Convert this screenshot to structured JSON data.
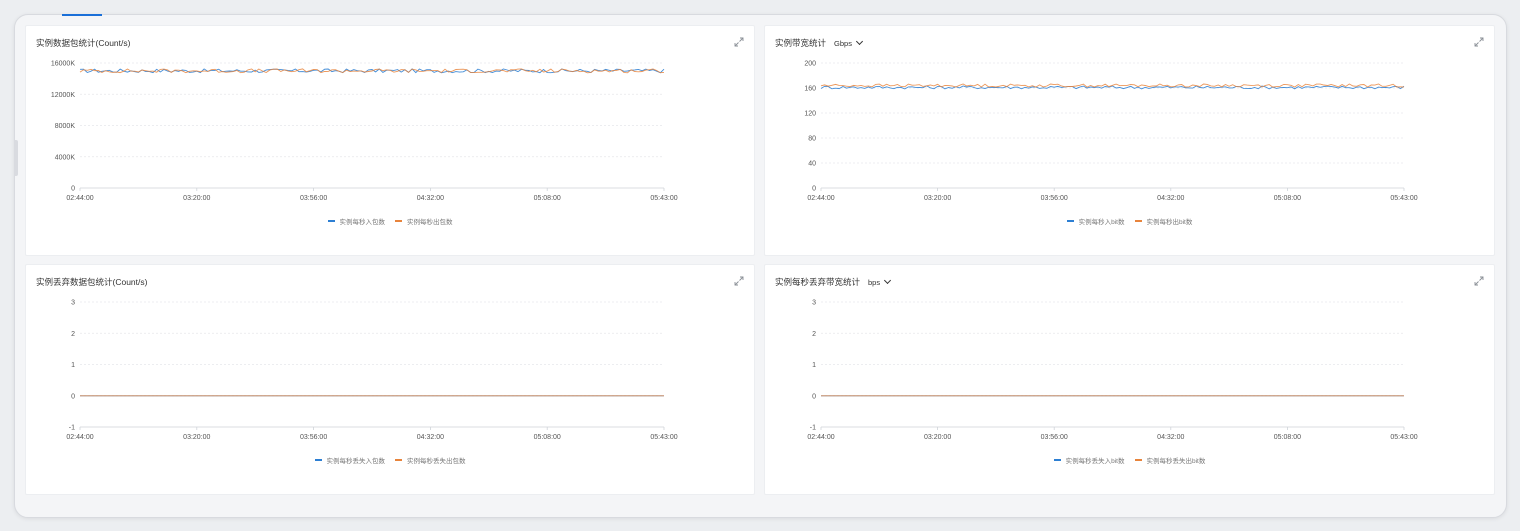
{
  "colors": {
    "series_in": "#2d7fd3",
    "series_out": "#e8843c",
    "grid": "#e6e8eb",
    "axis": "#cfd3d8"
  },
  "panels": [
    {
      "title": "实例数据包统计(Count/s)",
      "unit": "",
      "legend": [
        "实例每秒入包数",
        "实例每秒出包数"
      ]
    },
    {
      "title": "实例带宽统计",
      "unit": "Gbps",
      "legend": [
        "实例每秒入bit数",
        "实例每秒出bit数"
      ]
    },
    {
      "title": "实例丢弃数据包统计(Count/s)",
      "unit": "",
      "legend": [
        "实例每秒丢失入包数",
        "实例每秒丢失出包数"
      ]
    },
    {
      "title": "实例每秒丢弃带宽统计",
      "unit": "bps",
      "legend": [
        "实例每秒丢失入bit数",
        "实例每秒丢失出bit数"
      ]
    }
  ],
  "chart_data": [
    {
      "type": "line",
      "title": "实例数据包统计(Count/s)",
      "x_ticks": [
        "02:44:00",
        "03:20:00",
        "03:56:00",
        "04:32:00",
        "05:08:00",
        "05:43:00"
      ],
      "y_ticks": [
        "0",
        "4000K",
        "8000K",
        "12000K",
        "16000K"
      ],
      "ylim": [
        0,
        16000
      ],
      "y_unit": "K",
      "series": [
        {
          "name": "实例每秒入包数",
          "level": 15000,
          "noise": 250
        },
        {
          "name": "实例每秒出包数",
          "level": 15000,
          "noise": 250
        }
      ],
      "grid": true,
      "legend_position": "bottom"
    },
    {
      "type": "line",
      "title": "实例带宽统计",
      "x_ticks": [
        "02:44:00",
        "03:20:00",
        "03:56:00",
        "04:32:00",
        "05:08:00",
        "05:43:00"
      ],
      "y_ticks": [
        "0",
        "40",
        "80",
        "120",
        "160",
        "200"
      ],
      "ylim": [
        0,
        200
      ],
      "series": [
        {
          "name": "实例每秒入bit数",
          "level": 161,
          "noise": 2.5
        },
        {
          "name": "实例每秒出bit数",
          "level": 164,
          "noise": 2.5
        }
      ],
      "grid": true,
      "legend_position": "bottom"
    },
    {
      "type": "line",
      "title": "实例丢弃数据包统计(Count/s)",
      "x_ticks": [
        "02:44:00",
        "03:20:00",
        "03:56:00",
        "04:32:00",
        "05:08:00",
        "05:43:00"
      ],
      "y_ticks": [
        "-1",
        "0",
        "1",
        "2",
        "3"
      ],
      "ylim": [
        -1,
        3
      ],
      "series": [
        {
          "name": "实例每秒丢失入包数",
          "level": 0,
          "noise": 0
        },
        {
          "name": "实例每秒丢失出包数",
          "level": 0,
          "noise": 0
        }
      ],
      "grid": true,
      "legend_position": "bottom"
    },
    {
      "type": "line",
      "title": "实例每秒丢弃带宽统计",
      "x_ticks": [
        "02:44:00",
        "03:20:00",
        "03:56:00",
        "04:32:00",
        "05:08:00",
        "05:43:00"
      ],
      "y_ticks": [
        "-1",
        "0",
        "1",
        "2",
        "3"
      ],
      "ylim": [
        -1,
        3
      ],
      "series": [
        {
          "name": "实例每秒丢失入bit数",
          "level": 0,
          "noise": 0
        },
        {
          "name": "实例每秒丢失出bit数",
          "level": 0,
          "noise": 0
        }
      ],
      "grid": true,
      "legend_position": "bottom"
    }
  ]
}
